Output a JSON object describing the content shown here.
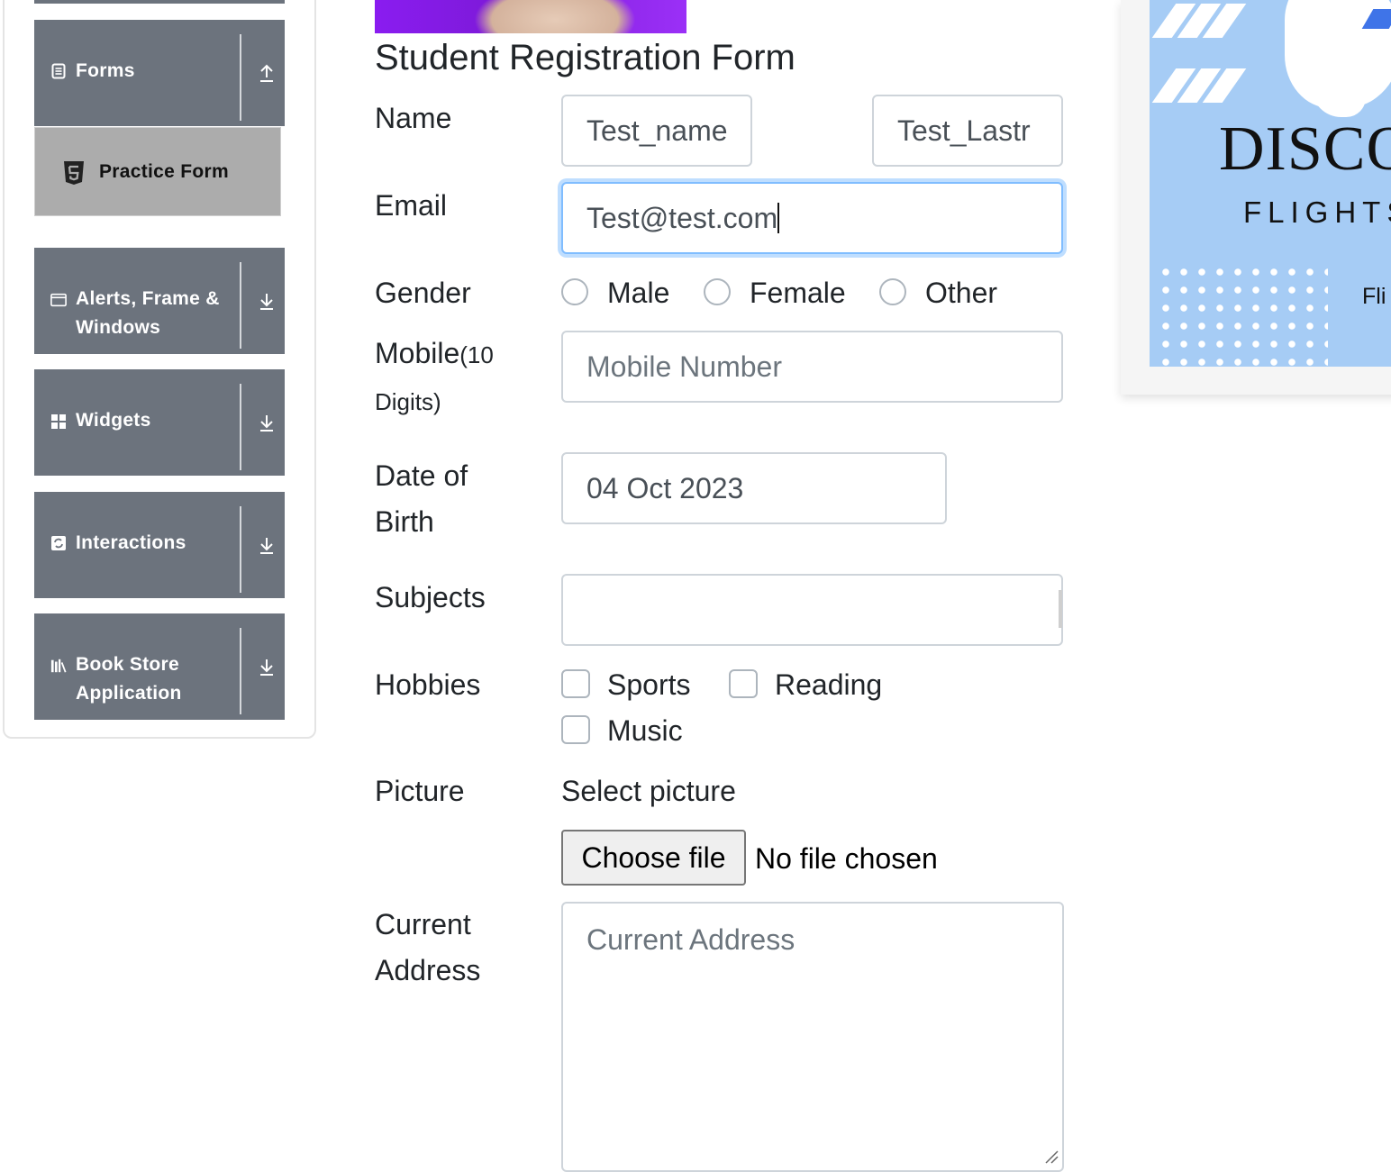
{
  "sidebar": {
    "forms_label": "Forms",
    "practice_form_label": "Practice Form",
    "alerts_label_line1": "Alerts, Frame &",
    "alerts_label_line2": "Windows",
    "widgets_label": "Widgets",
    "interactions_label": "Interactions",
    "bookstore_label_line1": "Book Store",
    "bookstore_label_line2": "Application"
  },
  "form": {
    "title": "Student Registration Form",
    "name_label": "Name",
    "first_name_value": "Test_name",
    "last_name_value": "Test_Lastr",
    "email_label": "Email",
    "email_value": "Test@test.com",
    "gender_label": "Gender",
    "gender_options": [
      "Male",
      "Female",
      "Other"
    ],
    "mobile_label": "Mobile",
    "mobile_hint": "(10",
    "mobile_hint2": "Digits)",
    "mobile_placeholder": "Mobile Number",
    "dob_label_line1": "Date of",
    "dob_label_line2": "Birth",
    "dob_value": "04 Oct 2023",
    "subjects_label": "Subjects",
    "subjects_value": "",
    "hobbies_label": "Hobbies",
    "hobbies": [
      "Sports",
      "Reading",
      "Music"
    ],
    "picture_label": "Picture",
    "picture_caption": "Select picture",
    "choose_file_label": "Choose file",
    "file_status": "No file chosen",
    "address_label_line1": "Current",
    "address_label_line2": "Address",
    "address_placeholder": "Current Address"
  },
  "ad": {
    "headline": "DISCO",
    "subline": "FLIGHTS",
    "tiny": "Fli",
    "background_color": "#a6ccf5"
  },
  "colors": {
    "sidebar_group": "#6c737d",
    "sidebar_active": "#acacac",
    "focus_border": "#80bdff"
  }
}
